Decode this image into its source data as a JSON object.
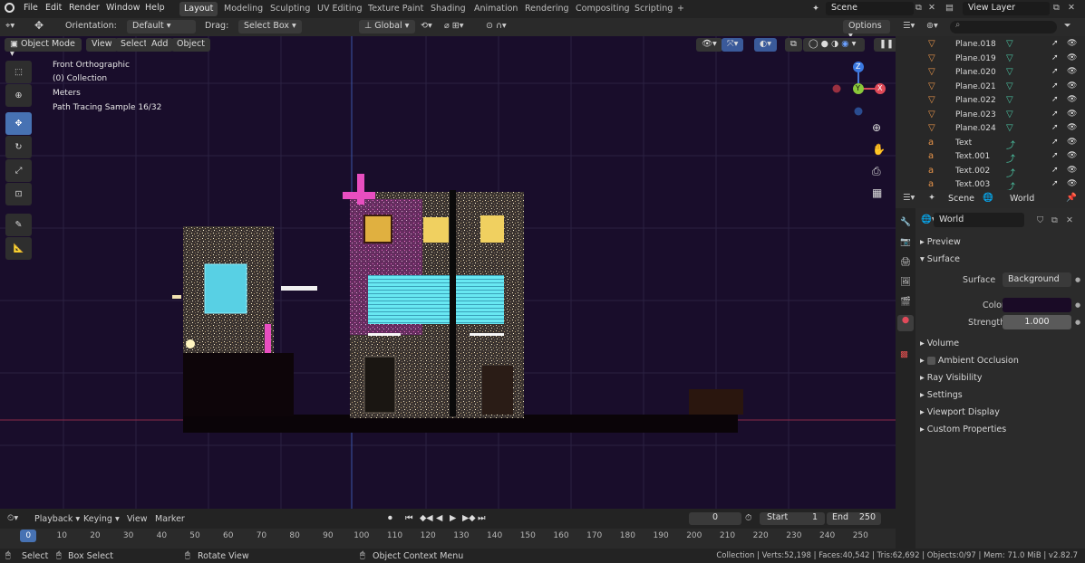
{
  "topbar": {
    "menus": [
      "File",
      "Edit",
      "Render",
      "Window",
      "Help"
    ],
    "workspaces": [
      "Layout",
      "Modeling",
      "Sculpting",
      "UV Editing",
      "Texture Paint",
      "Shading",
      "Animation",
      "Rendering",
      "Compositing",
      "Scripting"
    ],
    "active_workspace": "Layout",
    "add_tab": "+",
    "scene": "Scene",
    "view_layer": "View Layer"
  },
  "viewport_header": {
    "orientation_label": "Orientation:",
    "orientation_value": "Default",
    "drag_label": "Drag:",
    "drag_value": "Select Box",
    "transform_space": "Global",
    "options": "Options"
  },
  "viewport_menu": {
    "mode": "Object Mode",
    "items": [
      "View",
      "Select",
      "Add",
      "Object"
    ]
  },
  "overlay": {
    "view_name": "Front Orthographic",
    "collection": "(0) Collection",
    "units": "Meters",
    "render_status": "Path Tracing Sample 16/32"
  },
  "gizmo": {
    "z": "Z",
    "y": "Y",
    "x": "X"
  },
  "outliner": {
    "search_placeholder": "",
    "items": [
      {
        "name": "Plane.018",
        "type": "mesh"
      },
      {
        "name": "Plane.019",
        "type": "mesh"
      },
      {
        "name": "Plane.020",
        "type": "mesh"
      },
      {
        "name": "Plane.021",
        "type": "mesh"
      },
      {
        "name": "Plane.022",
        "type": "mesh"
      },
      {
        "name": "Plane.023",
        "type": "mesh"
      },
      {
        "name": "Plane.024",
        "type": "mesh"
      },
      {
        "name": "Text",
        "type": "text"
      },
      {
        "name": "Text.001",
        "type": "text"
      },
      {
        "name": "Text.002",
        "type": "text"
      },
      {
        "name": "Text.003",
        "type": "text"
      }
    ]
  },
  "properties": {
    "breadcrumb_scene": "Scene",
    "breadcrumb_world": "World",
    "world_name": "World",
    "panels": {
      "preview": "Preview",
      "surface": "Surface",
      "surface_label": "Surface",
      "surface_value": "Background",
      "color_label": "Color",
      "strength_label": "Strength",
      "strength_value": "1.000",
      "volume": "Volume",
      "ambient_occlusion": "Ambient Occlusion",
      "ray_visibility": "Ray Visibility",
      "settings": "Settings",
      "viewport_display": "Viewport Display",
      "custom_properties": "Custom Properties"
    },
    "world_color": "#1a0b26"
  },
  "timeline": {
    "menus": [
      "Playback",
      "Keying",
      "View",
      "Marker"
    ],
    "current_frame": "0",
    "start_label": "Start",
    "start_value": "1",
    "end_label": "End",
    "end_value": "250",
    "ruler": [
      "0",
      "10",
      "20",
      "30",
      "40",
      "50",
      "60",
      "70",
      "80",
      "90",
      "100",
      "110",
      "120",
      "130",
      "140",
      "150",
      "160",
      "170",
      "180",
      "190",
      "200",
      "210",
      "220",
      "230",
      "240",
      "250"
    ]
  },
  "status": {
    "select": "Select",
    "box_select": "Box Select",
    "rotate_view": "Rotate View",
    "context_menu": "Object Context Menu",
    "stats": "Collection | Verts:52,198 | Faces:40,542 | Tris:62,692 | Objects:0/97 | Mem: 71.0 MiB | v2.82.7"
  },
  "colors": {
    "accent": "#4772b3",
    "viewport_bg": "#190d2b",
    "neon_pink": "#e040c0",
    "neon_cyan": "#5ee6f0",
    "window_yellow": "#f0d060"
  }
}
